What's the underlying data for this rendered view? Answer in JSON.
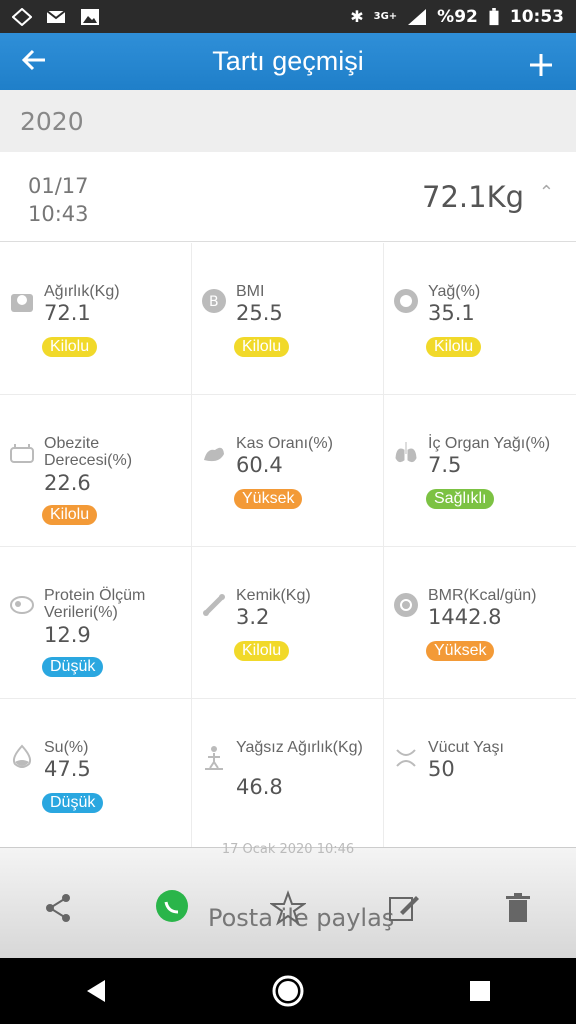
{
  "status_bar": {
    "battery": "%92",
    "time": "10:53",
    "network": "3G+"
  },
  "app_bar": {
    "title": "Tartı geçmişi"
  },
  "year": "2020",
  "entry": {
    "date": "01/17",
    "time": "10:43",
    "weight": "72.1Kg"
  },
  "metrics": [
    {
      "label": "Ağırlık(Kg)",
      "value": "72.1",
      "badge": "Kilolu",
      "badge_color": "#f1d92a",
      "icon": "scale-icon"
    },
    {
      "label": "BMI",
      "value": "25.5",
      "badge": "Kilolu",
      "badge_color": "#f1d92a",
      "icon": "bmi-icon"
    },
    {
      "label": "Yağ(%)",
      "value": "35.1",
      "badge": "Kilolu",
      "badge_color": "#f1d92a",
      "icon": "fat-icon"
    },
    {
      "label": "Obezite Derecesi(%)",
      "value": "22.6",
      "badge": "Kilolu",
      "badge_color": "#f39a37",
      "icon": "obesity-icon"
    },
    {
      "label": "Kas Oranı(%)",
      "value": "60.4",
      "badge": "Yüksek",
      "badge_color": "#f39a37",
      "icon": "muscle-icon"
    },
    {
      "label": "İç Organ Yağı(%)",
      "value": "7.5",
      "badge": "Sağlıklı",
      "badge_color": "#7cc243",
      "icon": "lungs-icon"
    },
    {
      "label": "Protein Ölçüm Verileri(%)",
      "value": "12.9",
      "badge": "Düşük",
      "badge_color": "#2aa7e0",
      "icon": "protein-icon"
    },
    {
      "label": "Kemik(Kg)",
      "value": "3.2",
      "badge": "Kilolu",
      "badge_color": "#f1d92a",
      "icon": "bone-icon"
    },
    {
      "label": "BMR(Kcal/gün)",
      "value": "1442.8",
      "badge": "Yüksek",
      "badge_color": "#f39a37",
      "icon": "bmr-icon"
    },
    {
      "label": "Su(%)",
      "value": "47.5",
      "badge": "Düşük",
      "badge_color": "#2aa7e0",
      "icon": "water-drop-icon"
    },
    {
      "label": "Yağsız Ağırlık(Kg)",
      "value": "46.8",
      "badge": "",
      "badge_color": "",
      "icon": "person-icon"
    },
    {
      "label": "Vücut Yaşı",
      "value": "50",
      "badge": "",
      "badge_color": "",
      "icon": "body-icon"
    }
  ],
  "share": {
    "timestamp": "17 Ocak 2020 10:46",
    "text": "Posta ile paylaş"
  }
}
